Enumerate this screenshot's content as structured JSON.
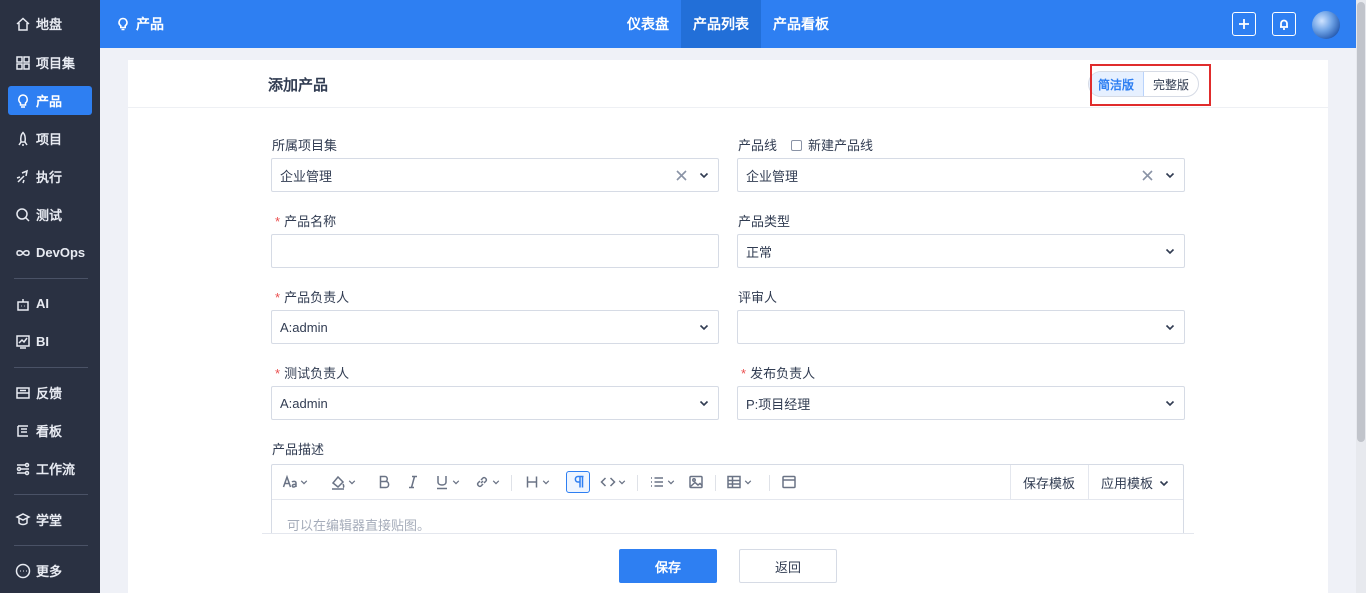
{
  "sidebar": {
    "items": [
      {
        "label": "地盘",
        "icon": "home-icon"
      },
      {
        "label": "项目集",
        "icon": "grid-icon"
      },
      {
        "label": "产品",
        "icon": "lightbulb-icon",
        "active": true
      },
      {
        "label": "项目",
        "icon": "rocket-icon"
      },
      {
        "label": "执行",
        "icon": "run-icon"
      },
      {
        "label": "测试",
        "icon": "test-search-icon"
      },
      {
        "label": "DevOps",
        "icon": "infinity-icon"
      },
      {
        "label": "AI",
        "icon": "robot-icon"
      },
      {
        "label": "BI",
        "icon": "chart-icon"
      },
      {
        "label": "反馈",
        "icon": "feedback-icon"
      },
      {
        "label": "看板",
        "icon": "kanban-icon"
      },
      {
        "label": "工作流",
        "icon": "workflow-icon"
      },
      {
        "label": "学堂",
        "icon": "school-icon"
      },
      {
        "label": "更多",
        "icon": "more-icon"
      }
    ]
  },
  "topbar": {
    "title": "产品",
    "tabs": [
      {
        "label": "仪表盘"
      },
      {
        "label": "产品列表",
        "active": true
      },
      {
        "label": "产品看板"
      }
    ],
    "accent": "#2e7ff2"
  },
  "form": {
    "title": "添加产品",
    "mode": {
      "simple": "简洁版",
      "full": "完整版"
    },
    "program": {
      "label": "所属项目集",
      "value": "企业管理"
    },
    "line": {
      "label": "产品线",
      "new_label": "新建产品线",
      "value": "企业管理"
    },
    "name": {
      "label": "产品名称",
      "value": ""
    },
    "type": {
      "label": "产品类型",
      "value": "正常"
    },
    "owner": {
      "label": "产品负责人",
      "value": "A:admin"
    },
    "reviewer": {
      "label": "评审人",
      "value": ""
    },
    "qa": {
      "label": "测试负责人",
      "value": "A:admin"
    },
    "release": {
      "label": "发布负责人",
      "value": "P:项目经理"
    },
    "desc": {
      "label": "产品描述",
      "placeholder": "可以在编辑器直接贴图。",
      "save_template": "保存模板",
      "apply_template": "应用模板"
    }
  },
  "footer": {
    "save": "保存",
    "back": "返回"
  },
  "colors": {
    "primary": "#2e7ff2",
    "sidebar": "#2a3142",
    "required": "#ea4e4e",
    "highlight_box": "#e02c2c"
  }
}
